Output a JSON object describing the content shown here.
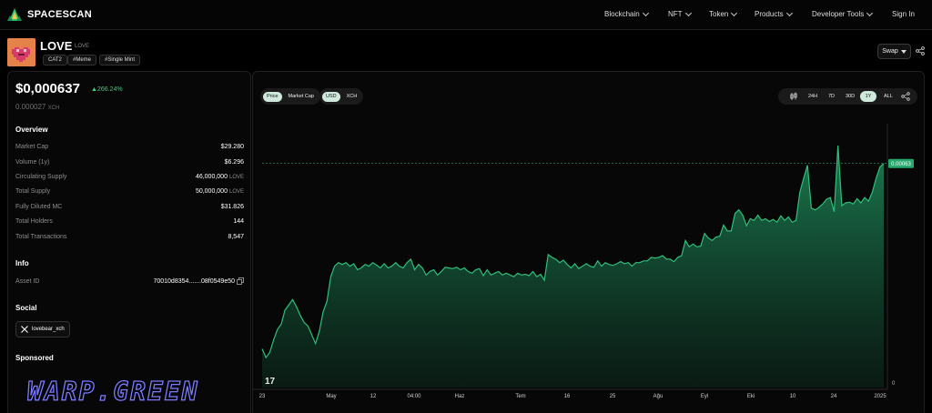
{
  "nav": {
    "brand": "SPACESCAN",
    "items": [
      {
        "label": "Blockchain",
        "x": 664
      },
      {
        "label": "NFT",
        "x": 734
      },
      {
        "label": "Token",
        "x": 779
      },
      {
        "label": "Products",
        "x": 829
      },
      {
        "label": "Developer Tools",
        "x": 892
      }
    ],
    "sign_in": "Sign In"
  },
  "token": {
    "name": "LOVE",
    "symbol": "LOVE",
    "tags": [
      "CAT2",
      "#Meme",
      "#Single Mint"
    ],
    "swap_label": "Swap"
  },
  "price": {
    "usd": "$0,000637",
    "change": "▲266.24%",
    "xch_value": "0.000027",
    "xch_unit": "XCH"
  },
  "overview": {
    "title": "Overview",
    "rows": [
      {
        "label": "Market Cap",
        "value": "$29.280",
        "unit": ""
      },
      {
        "label": "Volume (1y)",
        "value": "$6.296",
        "unit": ""
      },
      {
        "label": "Circulating Supply",
        "value": "46,000,000",
        "unit": "LOVE"
      },
      {
        "label": "Total Supply",
        "value": "50,000,000",
        "unit": "LOVE"
      },
      {
        "label": "Fully Diluted MC",
        "value": "$31.826",
        "unit": ""
      },
      {
        "label": "Total Holders",
        "value": "144",
        "unit": ""
      },
      {
        "label": "Total Transactions",
        "value": "8,547",
        "unit": ""
      }
    ]
  },
  "info": {
    "title": "Info",
    "asset_label": "Asset ID",
    "asset_value": "70010d8354.......08f0549e50"
  },
  "social": {
    "title": "Social",
    "handle": "lovebear_xch"
  },
  "sponsored": {
    "title": "Sponsored",
    "banner": "WARP.GREEN"
  },
  "chart_controls": {
    "metric": [
      "Price",
      "Market Cap"
    ],
    "metric_active": "Price",
    "currency": [
      "USD",
      "XCH"
    ],
    "currency_active": "USD",
    "ranges": [
      "24H",
      "7D",
      "30D",
      "1Y",
      "ALL"
    ],
    "range_active": "1Y"
  },
  "colors": {
    "accent_green": "#26a96c",
    "change_green": "#3fcf7f",
    "warp_purple": "#7a7aff"
  },
  "chart_data": {
    "type": "area",
    "current_price_label": "0.00063",
    "y_tick_label": "0",
    "x_tick_labels": [
      "23",
      "May",
      "12",
      "04:00",
      "Haz",
      "Tem",
      "16",
      "25",
      "Ağu",
      "Eyl",
      "Eki",
      "10",
      "24",
      "2025"
    ],
    "watermark": "17",
    "ylim": [
      0,
      0.00075
    ],
    "values": [
      0.00011,
      8.5e-05,
      0.0001,
      0.000135,
      0.000165,
      0.00018,
      0.00022,
      0.000235,
      0.00025,
      0.00023,
      0.000205,
      0.000185,
      0.000175,
      0.00015,
      0.000125,
      0.00016,
      0.000215,
      0.000245,
      0.000315,
      0.000345,
      0.000355,
      0.00035,
      0.000355,
      0.000345,
      0.000352,
      0.000335,
      0.00034,
      0.00035,
      0.000345,
      0.000355,
      0.000348,
      0.00034,
      0.000352,
      0.00034,
      0.000345,
      0.000355,
      0.000345,
      0.00034,
      0.000355,
      0.000365,
      0.000335,
      0.00035,
      0.00034,
      0.00032,
      0.00033,
      0.000335,
      0.00032,
      0.00033,
      0.000342,
      0.00034,
      0.000338,
      0.000342,
      0.000335,
      0.00034,
      0.00033,
      0.000325,
      0.000335,
      0.000338,
      0.000318,
      0.000335,
      0.00032,
      0.000325,
      0.00033,
      0.00032,
      0.000325,
      0.00032,
      0.000315,
      0.000325,
      0.00032,
      0.000322,
      0.000318,
      0.00033,
      0.000315,
      0.000322,
      0.000305,
      0.000378,
      0.00037,
      0.000365,
      0.000355,
      0.000362,
      0.00035,
      0.00034,
      0.000352,
      0.000338,
      0.000345,
      0.000352,
      0.000345,
      0.000342,
      0.00036,
      0.000345,
      0.000355,
      0.00035,
      0.000347,
      0.000352,
      0.000358,
      0.000352,
      0.000355,
      0.000345,
      0.000355,
      0.000355,
      0.00036,
      0.00036,
      0.00037,
      0.000368,
      0.00037,
      0.000375,
      0.000365,
      0.000365,
      0.000358,
      0.00037,
      0.000375,
      0.000418,
      0.0004,
      0.000408,
      0.0004,
      0.000402,
      0.000438,
      0.000425,
      0.000418,
      0.000428,
      0.00043,
      0.000462,
      0.000445,
      0.000445,
      0.000495,
      0.000505,
      0.00049,
      0.00046,
      0.00048,
      0.000475,
      0.00049,
      0.000475,
      0.00048,
      0.000472,
      0.000478,
      0.00047,
      0.000488,
      0.000475,
      0.000485,
      0.00047,
      0.000475,
      0.000555,
      0.000595,
      0.000632,
      0.00051,
      0.000505,
      0.000512,
      0.000522,
      0.000535,
      0.00054,
      0.0005,
      0.000688,
      0.000517,
      0.000525,
      0.000527,
      0.000522,
      0.000537,
      0.000525,
      0.00054,
      0.00053,
      0.000555,
      0.000595,
      0.000627,
      0.000637
    ]
  }
}
